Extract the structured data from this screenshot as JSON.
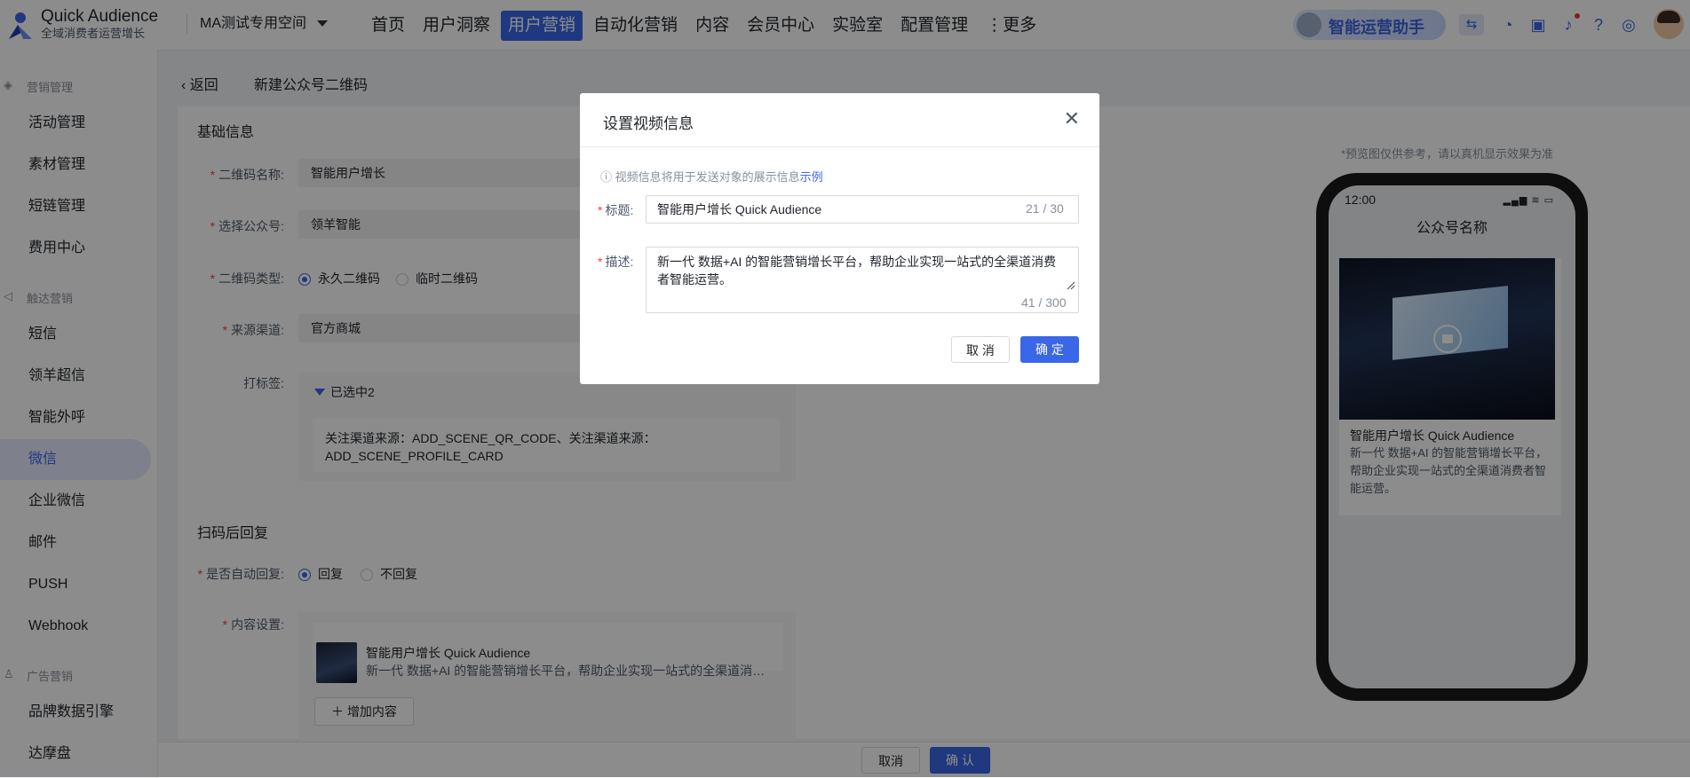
{
  "topbar": {
    "brand_name": "Quick Audience",
    "brand_tagline": "全域消费者运营增长",
    "workspace": "MA测试专用空间",
    "nav": [
      "首页",
      "用户洞察",
      "用户营销",
      "自动化营销",
      "内容",
      "会员中心",
      "实验室",
      "配置管理",
      "⋮更多"
    ],
    "assistant": "智能运营助手"
  },
  "sidebar": {
    "group1": "营销管理",
    "items1": [
      "活动管理",
      "素材管理",
      "短链管理",
      "费用中心"
    ],
    "group2": "触达营销",
    "items2": [
      "短信",
      "领羊超信",
      "智能外呼",
      "微信",
      "企业微信",
      "邮件",
      "PUSH",
      "Webhook"
    ],
    "group3": "广告营销",
    "items3": [
      "品牌数据引擎",
      "达摩盘"
    ]
  },
  "crumb": {
    "back": "返回",
    "title": "新建公众号二维码"
  },
  "form": {
    "basic_title": "基础信息",
    "qr_name_label": "二维码名称:",
    "qr_name_value": "智能用户增长",
    "account_label": "选择公众号:",
    "account_value": "领羊智能",
    "type_label": "二维码类型:",
    "type_options": [
      "永久二维码",
      "临时二维码"
    ],
    "source_label": "来源渠道:",
    "source_value": "官方商城",
    "tag_label": "打标签:",
    "tag_selected": "已选中2",
    "tag_content": "关注渠道来源：ADD_SCENE_QR_CODE、关注渠道来源：ADD_SCENE_PROFILE_CARD",
    "reply_title": "扫码后回复",
    "auto_reply_label": "是否自动回复:",
    "auto_reply_options": [
      "回复",
      "不回复"
    ],
    "content_label": "内容设置:",
    "content_title": "智能用户增长 Quick Audience",
    "content_desc": "新一代 数据+AI 的智能营销增长平台，帮助企业实现一站式的全渠道消费...",
    "add_content": "增加内容"
  },
  "preview": {
    "note": "*预览图仅供参考，请以真机显示效果为准",
    "time": "12:00",
    "account_name": "公众号名称",
    "video_title": "智能用户增长 Quick Audience",
    "video_desc": "新一代 数据+AI 的智能营销增长平台，帮助企业实现一站式的全渠道消费者智能运营。"
  },
  "footer": {
    "cancel": "取消",
    "confirm": "确 认"
  },
  "modal": {
    "title": "设置视频信息",
    "tip": "视频信息将用于发送对象的展示信息",
    "tip_link": "示例",
    "title_label": "标题:",
    "title_value": "智能用户增长 Quick Audience",
    "title_count": "21 / 30",
    "desc_label": "描述:",
    "desc_value": "新一代 数据+AI 的智能营销增长平台，帮助企业实现一站式的全渠道消费者智能运营。",
    "desc_count": "41 / 300",
    "cancel": "取 消",
    "ok": "确 定"
  }
}
